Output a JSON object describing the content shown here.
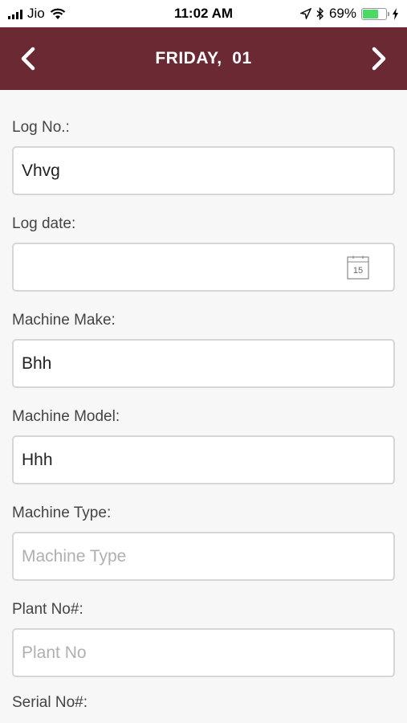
{
  "status_bar": {
    "carrier": "Jio",
    "time": "11:02 AM",
    "battery_percent": "69%",
    "battery_level": 0.69
  },
  "header": {
    "title": "FRIDAY,  01"
  },
  "form": {
    "fields": [
      {
        "label": "Log No.:",
        "value": "Vhvg",
        "placeholder": ""
      },
      {
        "label": "Log date:",
        "value": "",
        "placeholder": "",
        "icon": "calendar-icon",
        "icon_text": "15"
      },
      {
        "label": "Machine Make:",
        "value": "Bhh",
        "placeholder": ""
      },
      {
        "label": "Machine Model:",
        "value": "Hhh",
        "placeholder": ""
      },
      {
        "label": "Machine Type:",
        "value": "",
        "placeholder": "Machine Type"
      },
      {
        "label": "Plant No#:",
        "value": "",
        "placeholder": "Plant No"
      }
    ],
    "next_label": "Serial No#:"
  },
  "colors": {
    "header_bg": "#6b2a33",
    "battery_fill": "#4cd964"
  }
}
